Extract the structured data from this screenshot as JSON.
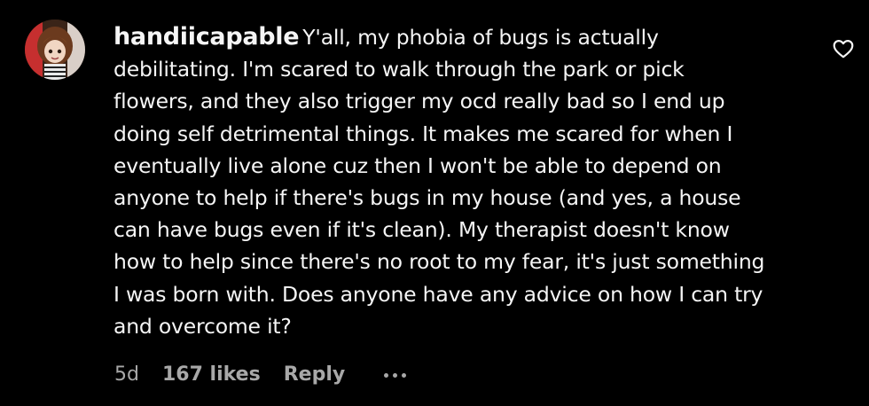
{
  "comment": {
    "username": "handiicapable",
    "text_lines": [
      "Y'all, my phobia of bugs is actually",
      "debilitating. I'm scared to walk through the park or pick",
      "flowers, and they also trigger my ocd really bad so I end up",
      "doing self detrimental things. It makes me scared for when I",
      "eventually live alone cuz then I won't be able to depend on",
      "anyone to help if there's bugs in my house (and yes, a house",
      "can have bugs even if it's clean). My therapist doesn't know",
      "how to help since there's no root to my fear, it's just something",
      "I was born with. Does anyone have any advice on how I can try",
      "and overcome it?"
    ],
    "time_ago": "5d",
    "likes": "167 likes",
    "reply_label": "Reply",
    "avatar_icon": "avatar-image",
    "like_icon": "heart-outline-icon",
    "more_icon": "ellipsis-icon"
  },
  "colors": {
    "background": "#000000",
    "text": "#f5f5f5",
    "meta_text": "#a8a8a8"
  }
}
